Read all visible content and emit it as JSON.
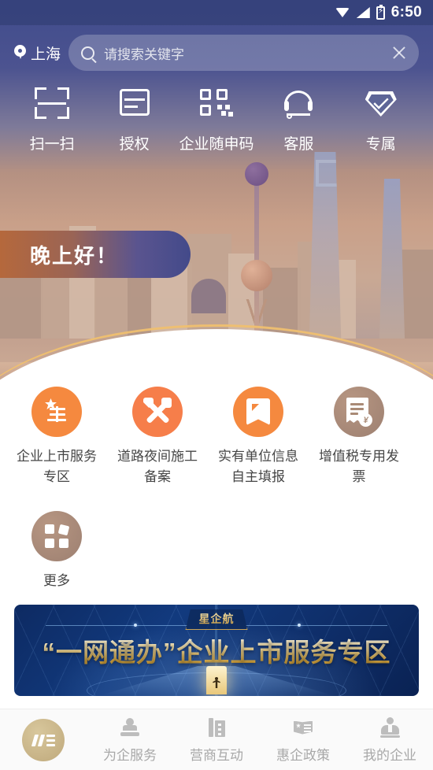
{
  "statusbar": {
    "time": "6:50",
    "icons": [
      "wifi-icon",
      "signal-icon",
      "battery-charging-icon"
    ]
  },
  "header": {
    "location": "上海",
    "location_icon": "location-pin-icon",
    "search": {
      "placeholder": "请搜索关键字",
      "value": "",
      "search_icon": "search-icon",
      "clear_icon": "close-icon"
    }
  },
  "quick_actions": [
    {
      "label": "扫一扫",
      "icon": "scan-icon"
    },
    {
      "label": "授权",
      "icon": "document-authorize-icon"
    },
    {
      "label": "企业随申码",
      "icon": "qr-code-icon"
    },
    {
      "label": "客服",
      "icon": "headset-service-icon"
    },
    {
      "label": "专属",
      "icon": "diamond-exclusive-icon"
    }
  ],
  "greeting": {
    "text": "晚上好！",
    "gradient_start": "#b5683c",
    "gradient_end": "#434a8a"
  },
  "hero": {
    "image_alt": "上海浦东天际线",
    "accent_arc_color": "#f0c070"
  },
  "services": [
    {
      "label": "企业上市服务专区",
      "icon": "star-seal-icon",
      "color": "#f5893f"
    },
    {
      "label": "道路夜间施工备案",
      "icon": "tools-icon",
      "color": "#f67e4a"
    },
    {
      "label": "实有单位信息自主填报",
      "icon": "bookmark-icon",
      "color": "#f5893f"
    },
    {
      "label": "增值税专用发票",
      "icon": "invoice-yuan-icon",
      "color": "#a98a76"
    },
    {
      "label": "更多",
      "icon": "grid-more-icon",
      "color": "#a98a76"
    }
  ],
  "banner": {
    "badge": "星企航",
    "title": "“一网通办”企业上市服务专区",
    "bg_color": "#0d2a62",
    "title_color": "#f0d48f"
  },
  "tabbar": {
    "logo_icon": "app-logo-icon",
    "items": [
      {
        "label": "为企服务",
        "icon": "stamp-icon"
      },
      {
        "label": "营商互动",
        "icon": "building-icon"
      },
      {
        "label": "惠企政策",
        "icon": "policy-book-icon"
      },
      {
        "label": "我的企业",
        "icon": "user-business-icon"
      }
    ],
    "label_color": "#a8a8a8"
  }
}
